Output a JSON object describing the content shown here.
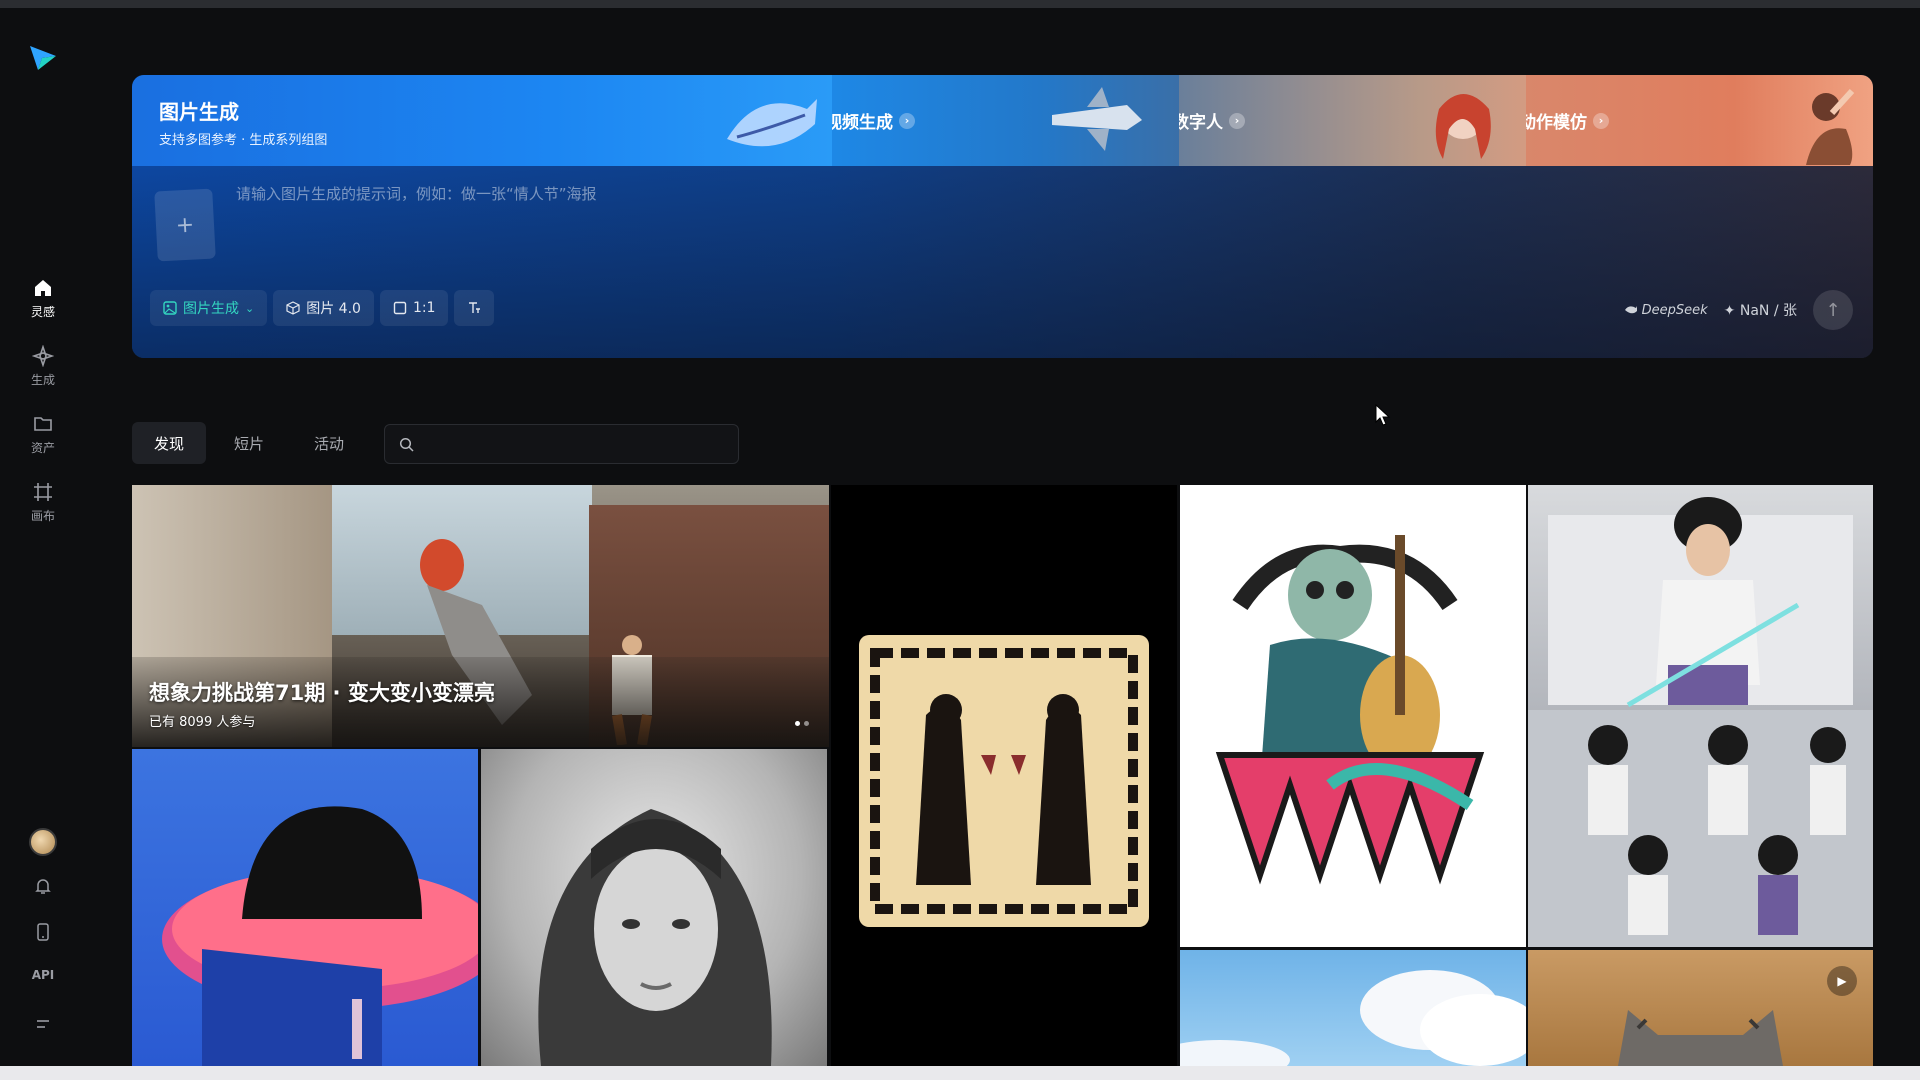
{
  "sidebar": {
    "items": [
      {
        "label": "灵感",
        "icon": "home-icon"
      },
      {
        "label": "生成",
        "icon": "sparkle-icon"
      },
      {
        "label": "资产",
        "icon": "folder-icon"
      },
      {
        "label": "画布",
        "icon": "canvas-icon"
      }
    ],
    "api_label": "API"
  },
  "hero": {
    "active_tab": {
      "title": "图片生成",
      "subtitle": "支持多图参考 · 生成系列组图"
    },
    "tabs": [
      {
        "label": "视频生成"
      },
      {
        "label": "数字人"
      },
      {
        "label": "动作模仿"
      }
    ],
    "prompt_placeholder": "请输入图片生成的提示词，例如：做一张“情人节”海报",
    "toolbar": {
      "mode_label": "图片生成",
      "model_label": "图片 4.0",
      "ratio_label": "1:1"
    },
    "deepseek_label": "DeepSeek",
    "cost_label": "✦ NaN / 张"
  },
  "filter": {
    "tabs": [
      "发现",
      "短片",
      "活动"
    ],
    "search_placeholder": ""
  },
  "featured": {
    "title": "想象力挑战第71期 · 变大变小变漂亮",
    "participants": "已有 8099 人参与"
  },
  "colors": {
    "accent": "#33d6c0",
    "hero_blue": "#1c86f2",
    "background": "#0d0e10"
  }
}
